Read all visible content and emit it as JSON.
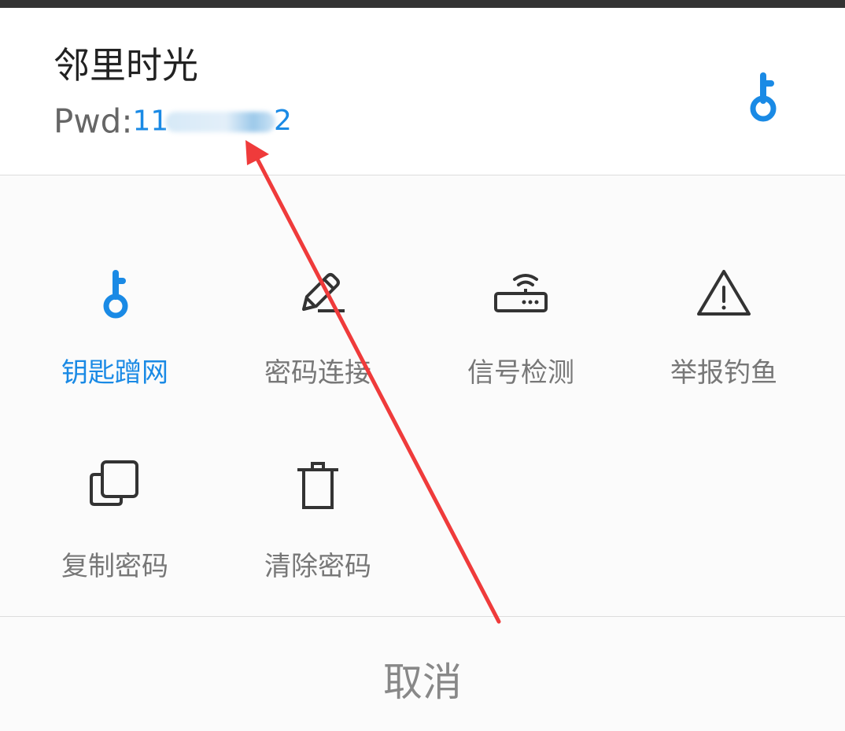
{
  "network": {
    "ssid": "邻里时光",
    "pwd_label": "Pwd:",
    "pwd_prefix": "11",
    "pwd_suffix": "2"
  },
  "icons": {
    "header_key": "key-icon",
    "key": "key-icon",
    "pencil": "pencil-icon",
    "router": "router-icon",
    "warning": "warning-icon",
    "copy": "copy-icon",
    "trash": "trash-icon"
  },
  "actions": [
    {
      "label": "钥匙蹭网",
      "active": true
    },
    {
      "label": "密码连接",
      "active": false
    },
    {
      "label": "信号检测",
      "active": false
    },
    {
      "label": "举报钓鱼",
      "active": false
    },
    {
      "label": "复制密码",
      "active": false
    },
    {
      "label": "清除密码",
      "active": false
    }
  ],
  "cancel_label": "取消",
  "colors": {
    "accent": "#1a8ae5",
    "text_dark": "#222222",
    "text_gray": "#777777",
    "annotation_arrow": "#ef3b3b"
  }
}
